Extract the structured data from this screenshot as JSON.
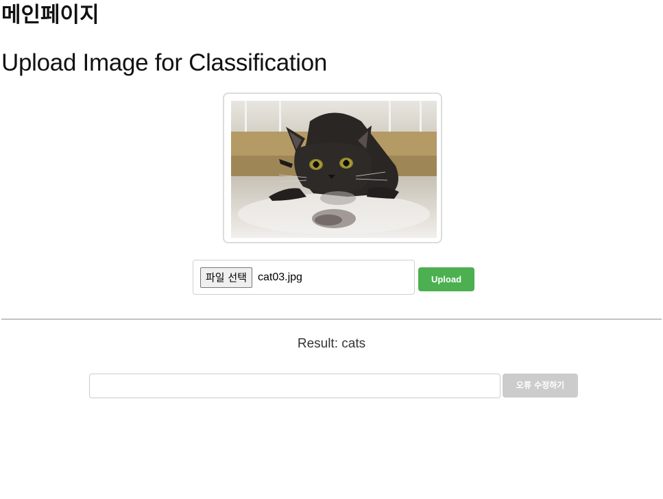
{
  "page": {
    "main_title": "메인페이지",
    "upload_title": "Upload Image for Classification"
  },
  "preview": {
    "image_description": "cat-photo"
  },
  "upload_form": {
    "file_button_label": "파일 선택",
    "file_name": "cat03.jpg",
    "upload_label": "Upload"
  },
  "result": {
    "text": "Result: cats"
  },
  "correction": {
    "input_value": "",
    "button_label": "오류 수정하기"
  },
  "colors": {
    "upload_button": "#4caf50",
    "fix_button_disabled": "#cccccc"
  }
}
